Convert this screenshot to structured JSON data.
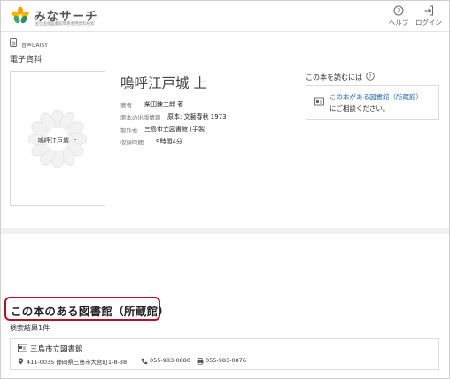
{
  "header": {
    "logo_text": "みなサーチ",
    "logo_sub": "国立国会図書館障害者用資料検索",
    "help_label": "ヘルプ",
    "login_label": "ログイン"
  },
  "item": {
    "format_label": "音声DAISY",
    "category": "電子資料",
    "cover_title": "嗚呼江戸城 上",
    "title": "嗚呼江戸城 上",
    "author_key": "著者",
    "author_value": "柴田錬三郎 著",
    "publisher_key": "原本の出版情報",
    "publisher_value": "原本: 文藝春秋 1973",
    "producer_key": "製作者",
    "producer_value": "三島市立図書館 (手製)",
    "duration_key": "収録時間",
    "duration_value": "9時間4分"
  },
  "read": {
    "heading": "この本を読むには",
    "link": "この本がある図書館（所蔵館）",
    "sub": "にご相談ください。"
  },
  "holdings": {
    "heading": "この本のある図書館（所蔵館）",
    "result_count": "検索結果1件",
    "library": {
      "name": "三島市立図書館",
      "address": "411-0035 静岡県三島市大宮町1-8-38",
      "tel": "055-983-0880",
      "fax": "055-983-0876"
    }
  },
  "colors": {
    "accent_link": "#1a66b8",
    "highlight_border": "#b7102a",
    "logo_orange": "#f0a000",
    "logo_green": "#3aa76d"
  }
}
